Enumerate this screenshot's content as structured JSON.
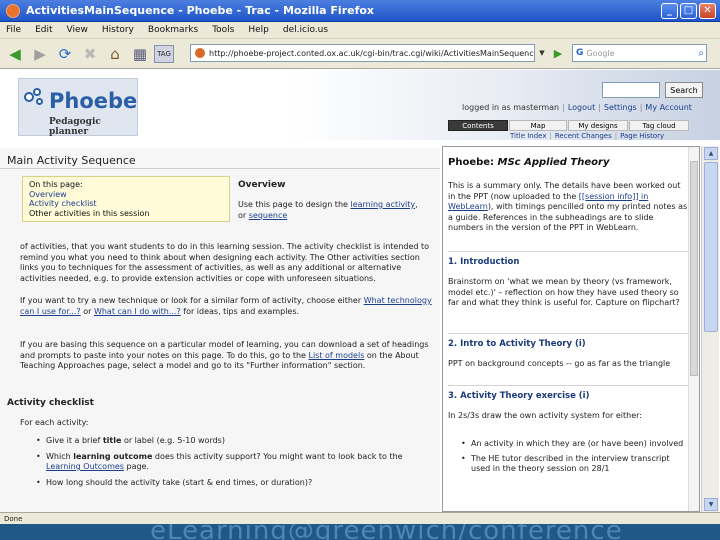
{
  "window": {
    "title": "ActivitiesMainSequence - Phoebe - Trac - Mozilla Firefox",
    "minimize": "_",
    "maximize": "□",
    "close": "✕"
  },
  "menubar": [
    "File",
    "Edit",
    "View",
    "History",
    "Bookmarks",
    "Tools",
    "Help",
    "del.icio.us"
  ],
  "toolbar": {
    "url": "http://phoebe-project.conted.ox.ac.uk/cgi-bin/trac.cgi/wiki/ActivitiesMainSequence#Phoebe:Activities",
    "search_placeholder": "Google",
    "tac_label": "TAG"
  },
  "site": {
    "logo_name": "Phoebe",
    "logo_sub": "Pedagogic planner",
    "search_button": "Search",
    "metanav": [
      "logged in as masterman",
      "Logout",
      "Settings",
      "My Account"
    ],
    "tabs": [
      "Contents",
      "Map",
      "My designs",
      "Tag cloud"
    ],
    "subnav": [
      "Title Index",
      "Recent Changes",
      "Page History"
    ]
  },
  "main": {
    "title": "Main Activity Sequence",
    "toc": {
      "title": "On this page:",
      "items": [
        "Overview",
        "Activity checklist",
        "Other activities in this session"
      ]
    },
    "overview_heading": "Overview",
    "overview_p1_a": "Use this page to design the",
    "overview_p1_link1": "learning activity",
    "overview_p1_b": ", or",
    "overview_p1_link2": "sequence",
    "overview_p1_c": "of activities, that you want students to do in this learning session. The activity checklist is intended to remind you what you need to think about when designing each activity. The Other activities section links you to techniques for the assessment of activities, as well as any additional or alternative activities needed, e.g. to provide extension activities or cope with unforeseen situations.",
    "para2_a": "If you want to try a new technique or look for a similar form of activity, choose either",
    "para2_link1": "What technology can I use for...?",
    "para2_b": "or",
    "para2_link2": "What can I do with...?",
    "para2_c": "for ideas, tips and examples.",
    "para3_a": "If you are basing this sequence on a particular model of learning, you can download a set of headings and prompts to paste into your notes on this page. To do this, go to the",
    "para3_link": "List of models",
    "para3_b": "on the About Teaching Approaches page, select a model and go to its \"Further information\" section.",
    "checklist_heading": "Activity checklist",
    "checklist_intro": "For each activity:",
    "checklist": [
      {
        "a": "Give it a brief ",
        "b": "title",
        "c": " or label (e.g. 5-10 words)",
        "link": ""
      },
      {
        "a": "Which ",
        "b": "learning outcome",
        "c": " does this activity support? You might want to look back to the ",
        "link": "Learning Outcomes",
        "d": " page."
      },
      {
        "a": "How long should the activity take (start & end times, or duration)?",
        "b": "",
        "c": "",
        "link": ""
      }
    ]
  },
  "side": {
    "title_a": "Phoebe: ",
    "title_b": "MSc Applied Theory",
    "intro_a": "This is a summary only. The details have been worked out in the PPT (now uploaded to the",
    "intro_link": "[[session info]] in WebLearn",
    "intro_b": "), with timings pencilled onto my printed notes as a guide. References in the subheadings are to slide numbers in the version of the PPT in WebLearn.",
    "s1_heading": "1. Introduction",
    "s1_text": "Brainstorm on 'what we mean by theory (vs framework, model etc.)' – reflection on how they have used theory so far and what they think is useful for. Capture on flipchart?",
    "s2_heading": "2. Intro to Activity Theory (i)",
    "s2_text": "PPT on background concepts -- go as far as the triangle",
    "s3_heading": "3. Activity Theory exercise (i)",
    "s3_text": "In 2s/3s draw the own activity system for either:",
    "s3_bullets": [
      "An activity in which they are (or have been) involved",
      "The HE tutor described in the interview transcript used in the theory session on 28/1"
    ]
  },
  "status": {
    "text": "Done"
  },
  "overlay": {
    "text": "eLearning@greenwich/conference"
  }
}
